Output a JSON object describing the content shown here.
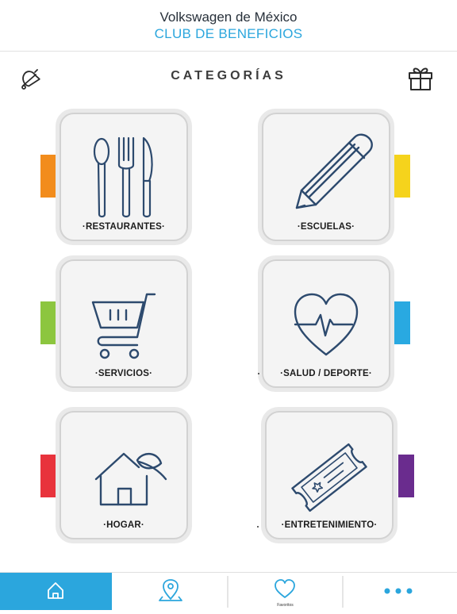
{
  "header": {
    "brand": "Volkswagen de México",
    "club": "CLUB DE BENEFICIOS"
  },
  "toolbar": {
    "title": "CATEGORÍAS",
    "left_icon": "bell-icon",
    "right_icon": "gift-icon"
  },
  "categories": [
    {
      "label": "RESTAURANTES",
      "icon": "cutlery-icon",
      "accent": "#f28c1c"
    },
    {
      "label": "ESCUELAS",
      "icon": "pencil-icon",
      "accent": "#f5d31c"
    },
    {
      "label": "SERVICIOS",
      "icon": "cart-icon",
      "accent": "#8cc63f"
    },
    {
      "label": "SALUD / DEPORTE",
      "icon": "heart-pulse-icon",
      "accent": "#29a9e1"
    },
    {
      "label": "HOGAR",
      "icon": "house-leaf-icon",
      "accent": "#e8333c"
    },
    {
      "label": "ENTRETENIMIENTO",
      "icon": "ticket-icon",
      "accent": "#6a2c8e"
    }
  ],
  "bottom_nav": [
    {
      "icon": "home-icon",
      "label": "",
      "active": true
    },
    {
      "icon": "location-pin-icon",
      "label": ""
    },
    {
      "icon": "heart-icon",
      "label": "Favoritos"
    },
    {
      "icon": "more-dots-icon",
      "label": ""
    }
  ],
  "colors": {
    "accent_blue": "#2ba6dd",
    "icon_navy": "#2d4a6e"
  }
}
